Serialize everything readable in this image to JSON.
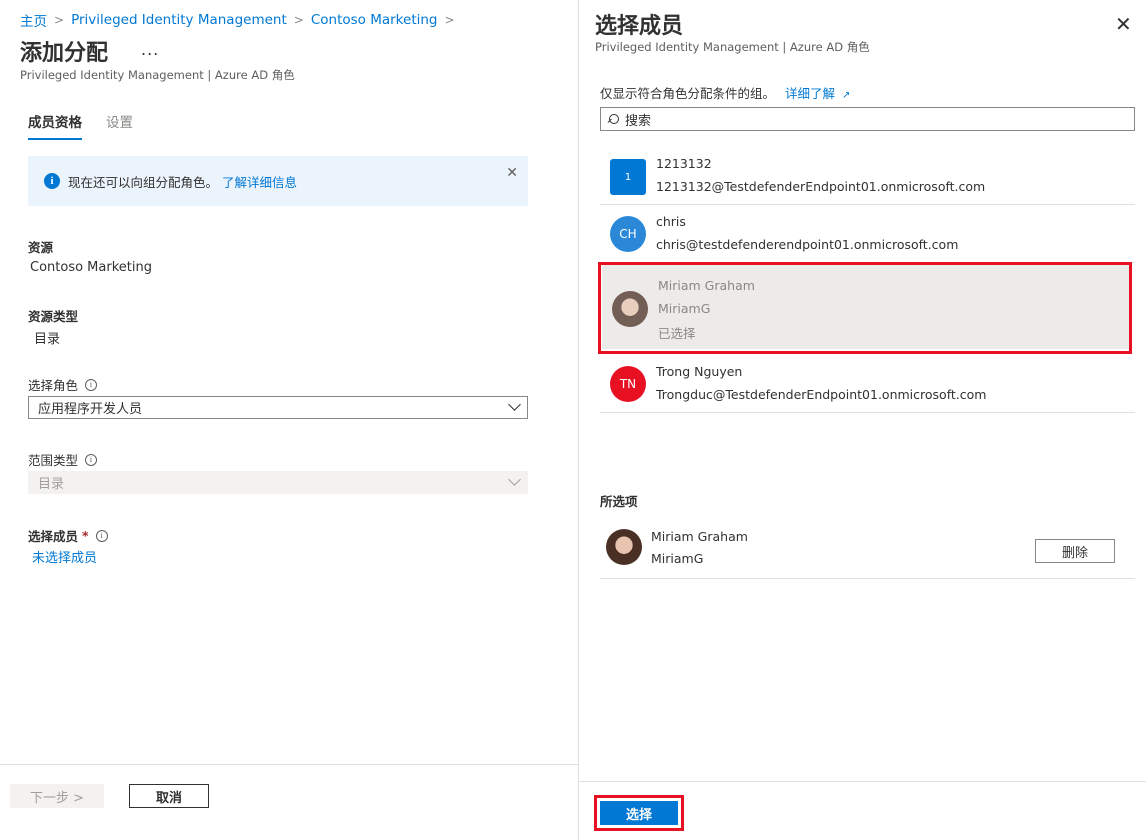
{
  "breadcrumb": {
    "items": [
      "主页",
      "Privileged Identity Management",
      "Contoso Marketing"
    ]
  },
  "page": {
    "title": "添加分配",
    "more": "...",
    "subtitle": "Privileged Identity Management | Azure AD 角色"
  },
  "tabs": [
    {
      "label": "成员资格",
      "active": true
    },
    {
      "label": "设置",
      "active": false
    }
  ],
  "info_bar": {
    "text": "现在还可以向组分配角色。",
    "link": "了解详细信息",
    "close": "✕"
  },
  "form": {
    "resource_label": "资源",
    "resource_value": "Contoso Marketing",
    "resource_type_label": "资源类型",
    "resource_type_value": "目录",
    "role_label": "选择角色",
    "role_value": "应用程序开发人员",
    "scope_label": "范围类型",
    "scope_value": "目录",
    "members_label": "选择成员",
    "members_required": "*",
    "members_value": "未选择成员"
  },
  "footer": {
    "next_label": "下一步 >",
    "cancel_label": "取消"
  },
  "panel": {
    "title": "选择成员",
    "subtitle": "Privileged Identity Management | Azure AD 角色",
    "close": "✕",
    "filter_note": "仅显示符合角色分配条件的组。",
    "filter_link": "详细了解",
    "search_placeholder": "搜索",
    "members": [
      {
        "initials": "1",
        "name": "1213132",
        "email": "1213132@TestdefenderEndpoint01.onmicrosoft.com",
        "color": "#0078d4"
      },
      {
        "initials": "CH",
        "name": "chris",
        "email": "chris@testdefenderendpoint01.onmicrosoft.com",
        "color": "#2b88d8"
      },
      {
        "name": "Miriam Graham",
        "email": "MiriamG",
        "status": "已选择"
      },
      {
        "initials": "TN",
        "name": "Trong Nguyen",
        "email": "Trongduc@TestdefenderEndpoint01.onmicrosoft.com",
        "color": "#e81123"
      }
    ],
    "selected_heading": "所选项",
    "selected": {
      "name": "Miriam Graham",
      "email": "MiriamG"
    },
    "remove_label": "删除",
    "select_label": "选择"
  },
  "colors": {
    "accent": "#0078d4",
    "highlight": "#e81123"
  }
}
